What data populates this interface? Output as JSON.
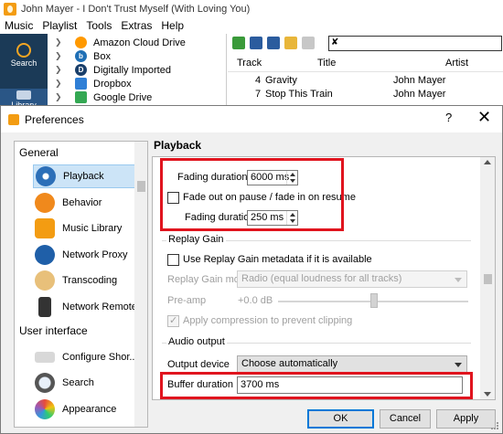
{
  "app": {
    "title": "John Mayer - I Don't Trust Myself (With Loving You)",
    "menu": [
      "Music",
      "Playlist",
      "Tools",
      "Extras",
      "Help"
    ],
    "side_buttons": [
      {
        "label": "Search",
        "icon": "search-icon"
      },
      {
        "label": "Library",
        "icon": "library-icon"
      }
    ],
    "tree_items": [
      {
        "label": "Amazon Cloud Drive",
        "icon": "cloud-icon"
      },
      {
        "label": "Box",
        "icon": "box-icon"
      },
      {
        "label": "Digitally Imported",
        "icon": "di-icon"
      },
      {
        "label": "Dropbox",
        "icon": "dropbox-icon"
      },
      {
        "label": "Google Drive",
        "icon": "google-drive-icon"
      }
    ],
    "track_columns": [
      "Track",
      "Title",
      "Artist"
    ],
    "tracks": [
      {
        "track": "4",
        "title": "Gravity",
        "artist": "John Mayer"
      },
      {
        "track": "7",
        "title": "Stop This Train",
        "artist": "John Mayer"
      }
    ]
  },
  "dialog": {
    "title": "Preferences",
    "help": "?",
    "close": "✕",
    "categories": {
      "header_general": "General",
      "header_ui": "User interface",
      "items": [
        {
          "label": "Playback",
          "icon": "playback-icon"
        },
        {
          "label": "Behavior",
          "icon": "behavior-icon"
        },
        {
          "label": "Music Library",
          "icon": "music-library-icon"
        },
        {
          "label": "Network Proxy",
          "icon": "network-proxy-icon"
        },
        {
          "label": "Transcoding",
          "icon": "transcoding-icon"
        },
        {
          "label": "Network Remote",
          "icon": "network-remote-icon"
        },
        {
          "label": "Configure Shor...",
          "icon": "keyboard-icon"
        },
        {
          "label": "Search",
          "icon": "search-icon"
        },
        {
          "label": "Appearance",
          "icon": "appearance-icon"
        }
      ]
    },
    "page_title": "Playback",
    "fade": {
      "fading_duration_label": "Fading duration",
      "fading_duration_value": "6000 ms",
      "fade_pause_label": "Fade out on pause / fade in on resume",
      "fading_duration2_label": "Fading duration",
      "fading_duration2_value": "250 ms"
    },
    "replay_gain": {
      "title": "Replay Gain",
      "use_label": "Use Replay Gain metadata if it is available",
      "mode_label": "Replay Gain mode",
      "mode_value": "Radio (equal loudness for all tracks)",
      "preamp_label": "Pre-amp",
      "preamp_value": "+0.0 dB",
      "compression_label": "Apply compression to prevent clipping"
    },
    "audio_output": {
      "title": "Audio output",
      "device_label": "Output device",
      "device_value": "Choose automatically",
      "buffer_label": "Buffer duration",
      "buffer_value": "3700 ms"
    },
    "buttons": {
      "ok": "OK",
      "cancel": "Cancel",
      "apply": "Apply"
    },
    "colors": {
      "highlight": "#e0141e",
      "selection": "#cce4f7"
    }
  }
}
